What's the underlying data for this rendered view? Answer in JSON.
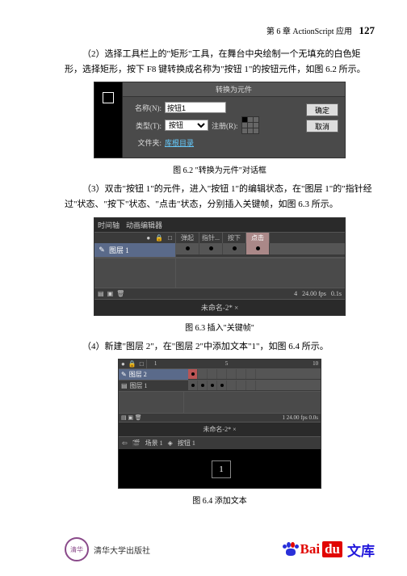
{
  "header": {
    "chapter": "第 6 章   ActionScript 应用",
    "page": "127"
  },
  "para2": "（2）选择工具栏上的\"矩形\"工具，在舞台中央绘制一个无填充的白色矩形，选择矩形，按下 F8 键转换成名称为\"按钮 1\"的按钮元件，如图 6.2 所示。",
  "fig62": {
    "caption": "图 6.2   \"转换为元件\"对话框",
    "title": "转换为元件",
    "name_label": "名称(N):",
    "name_value": "按钮1",
    "type_label": "类型(T):",
    "type_value": "按钮",
    "reg_label": "注册(R):",
    "folder_label": "文件夹:",
    "folder_value": "库根目录",
    "ok": "确定",
    "cancel": "取消"
  },
  "para3": "（3）双击\"按钮 1\"的元件，进入\"按钮 1\"的编辑状态，在\"图层 1\"的\"指针经过\"状态、\"按下\"状态、\"点击\"状态，分别插入关键帧，如图 6.3 所示。",
  "fig63": {
    "caption": "图 6.3   插入\"关键帧\"",
    "tab1": "时间轴",
    "tab2": "动画编辑器",
    "layer1": "图层 1",
    "states": [
      "弹起",
      "指针...",
      "按下",
      "点击"
    ],
    "scene_tab": "未命名-2* ×",
    "status_frame": "4",
    "status_fps": "24.00 fps",
    "status_time": "0.1s"
  },
  "para4": "（4）新建\"图层 2\"，在\"图层 2\"中添加文本\"1\"，如图 6.4 所示。",
  "fig64": {
    "caption": "图 6.4   添加文本",
    "layer2": "图层 2",
    "layer1": "图层 1",
    "frame_nums": [
      "1",
      "5",
      "10"
    ],
    "scene_tab": "未命名-2* ×",
    "crumb_scene": "场景 1",
    "crumb_btn": "按钮 1",
    "stage_text": "1",
    "status_frame": "1",
    "status_fps": "24.00 fps",
    "status_time": "0.0s"
  },
  "footer": {
    "publisher": "清华大学出版社",
    "baidu_bai": "Bai",
    "baidu_du": "du",
    "baidu_wenku": "文库"
  }
}
